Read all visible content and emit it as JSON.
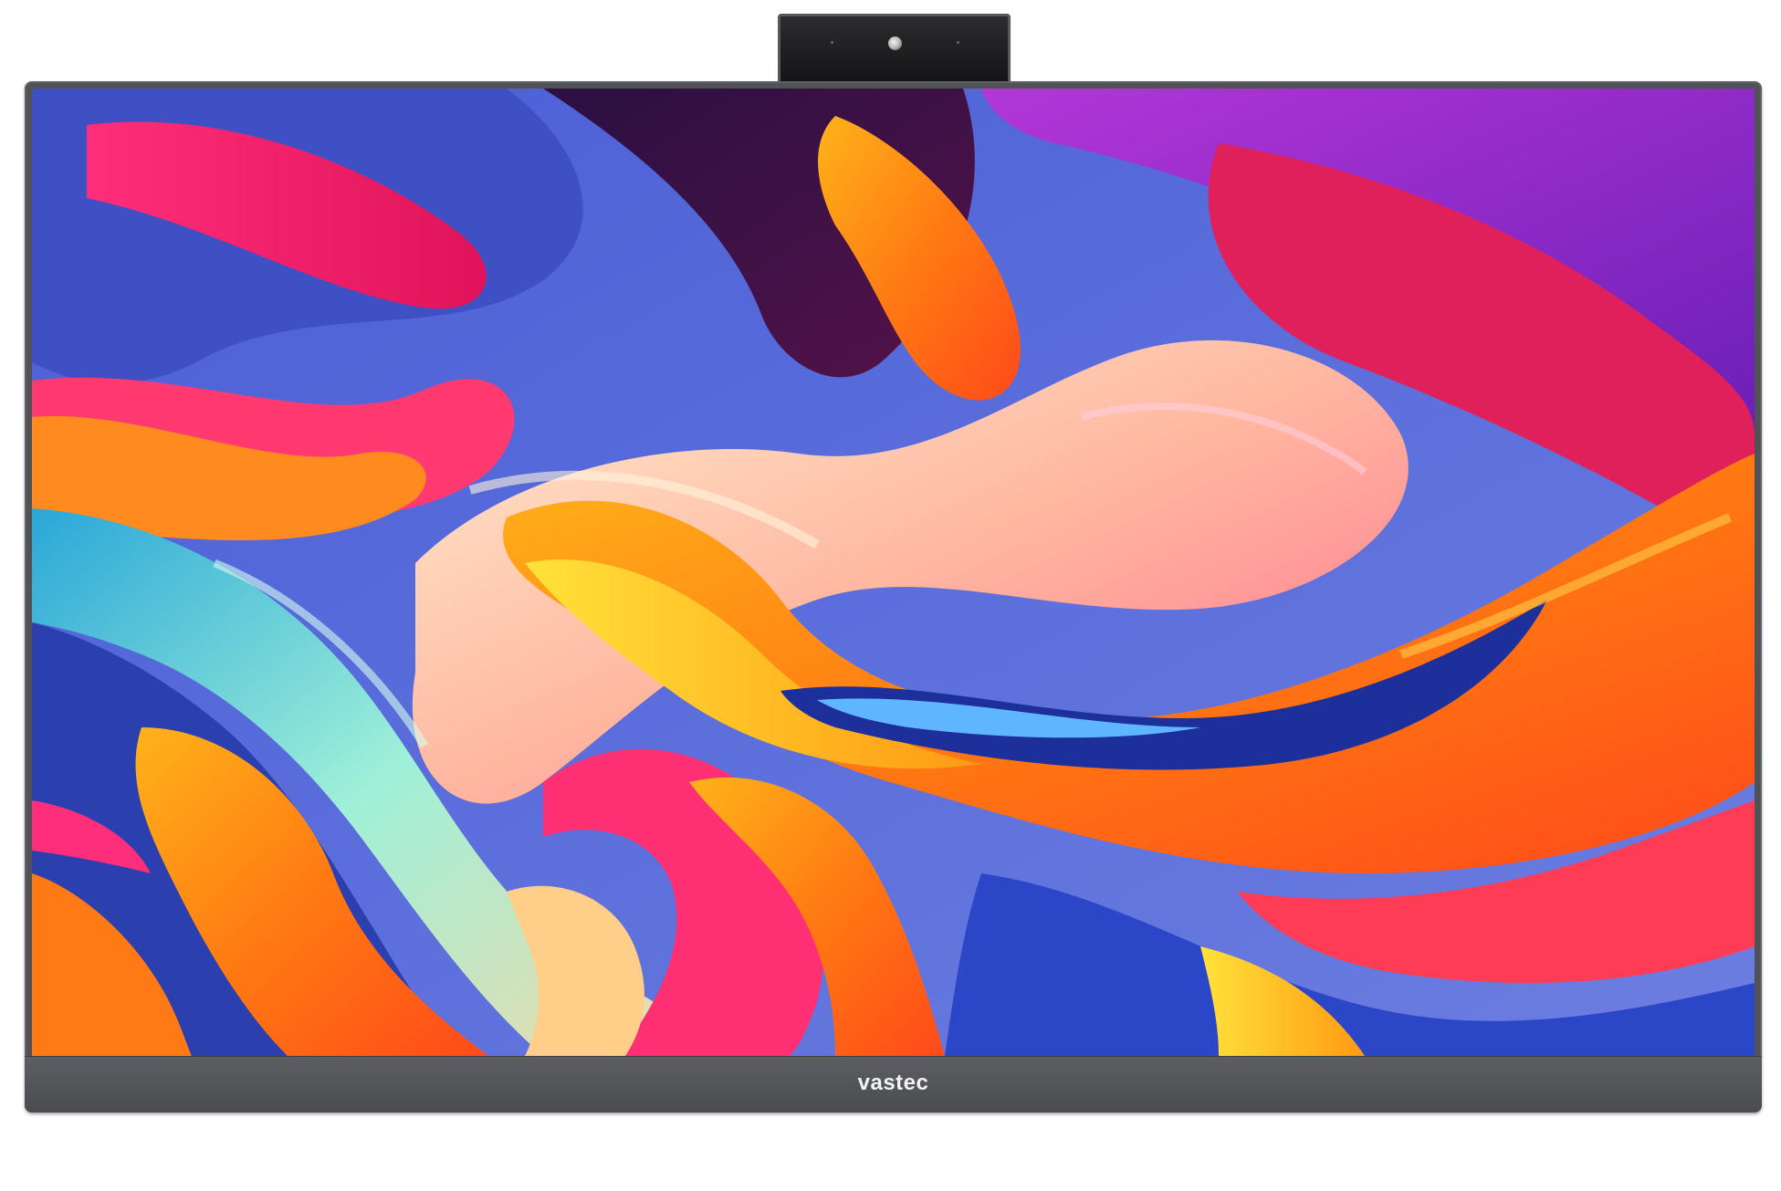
{
  "monitor": {
    "brand_label": "vastec",
    "bezel_color": "#505256",
    "wallpaper_palette": [
      "#5a68c8",
      "#ff2d6f",
      "#ff7a1a",
      "#ffc21a",
      "#8a2be2",
      "#2f5fd0",
      "#ffd3b0"
    ]
  }
}
